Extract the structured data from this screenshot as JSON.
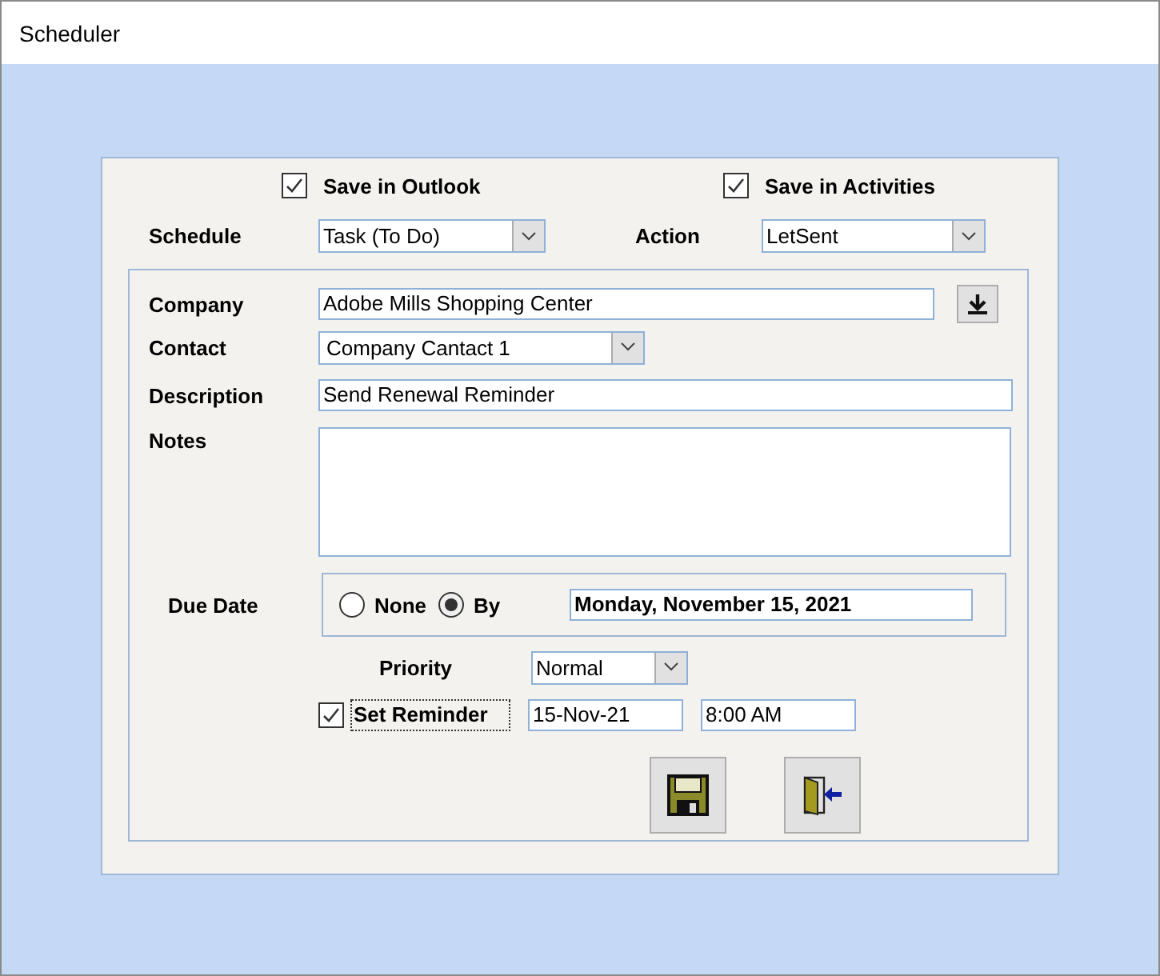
{
  "window": {
    "title": "Scheduler"
  },
  "options": [
    {
      "label": "Save in Outlook",
      "checked": true
    },
    {
      "label": "Save in Activities",
      "checked": true
    }
  ],
  "schedule": {
    "label": "Schedule",
    "value": "Task (To Do)"
  },
  "action": {
    "label": "Action",
    "value": "LetSent"
  },
  "company": {
    "label": "Company",
    "value": "Adobe Mills Shopping Center"
  },
  "contact": {
    "label": "Contact",
    "value": "Company Cantact 1"
  },
  "description": {
    "label": "Description",
    "value": "Send Renewal Reminder"
  },
  "notes": {
    "label": "Notes"
  },
  "due_date": {
    "label": "Due Date",
    "value": "Monday, November 15, 2021",
    "options": [
      {
        "label": "None",
        "selected": false
      },
      {
        "label": "By",
        "selected": true
      }
    ]
  },
  "priority": {
    "label": "Priority",
    "value": "Normal"
  },
  "reminder": {
    "label": "Set Reminder",
    "checked": true,
    "focused": true,
    "date": "15-Nov-21",
    "time": "8:00 AM"
  }
}
